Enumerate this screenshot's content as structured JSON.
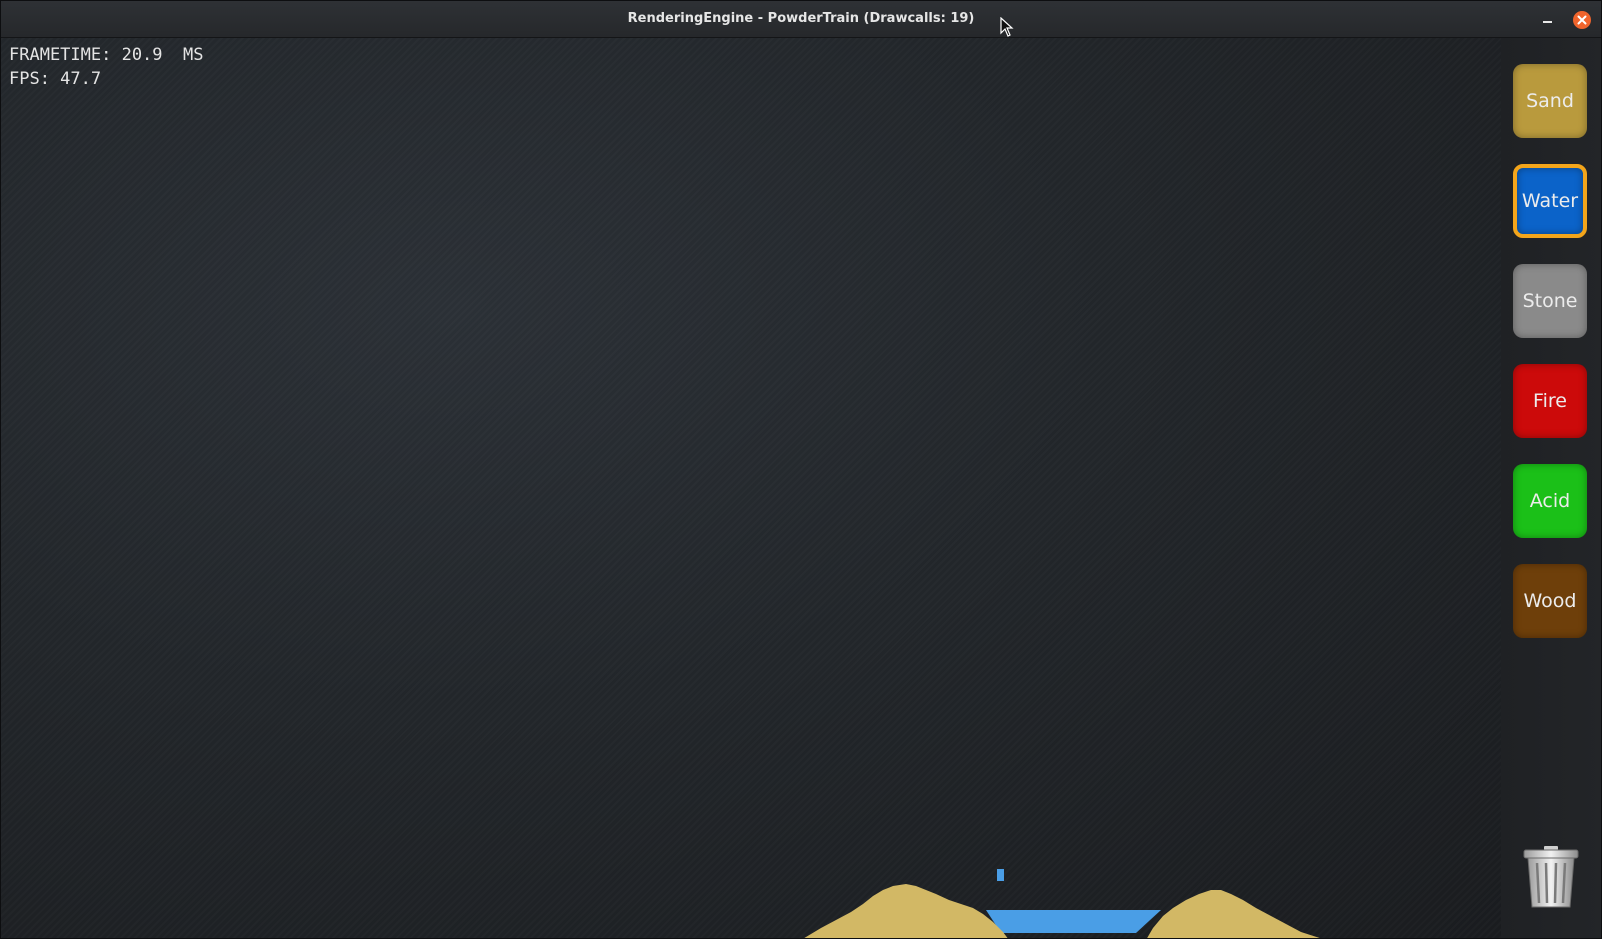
{
  "window": {
    "title": "RenderingEngine - PowderTrain (Drawcalls: 19)"
  },
  "hud": {
    "frametime": "FRAMETIME: 20.9  MS",
    "fps": "FPS: 47.7"
  },
  "materials": [
    {
      "label": "Sand",
      "color": "#b99a3d",
      "selected": false
    },
    {
      "label": "Water",
      "color": "#0b63c9",
      "selected": true
    },
    {
      "label": "Stone",
      "color": "#8a8a8a",
      "selected": false
    },
    {
      "label": "Fire",
      "color": "#cc0a0a",
      "selected": false
    },
    {
      "label": "Acid",
      "color": "#1bc018",
      "selected": false
    },
    {
      "label": "Wood",
      "color": "#6e3f0a",
      "selected": false
    }
  ],
  "colors": {
    "sand": "#d2b865",
    "water": "#4a9ee6",
    "selection_border": "#f3a51b",
    "close_button": "#f0642c"
  },
  "icons": {
    "minimize": "minimize-icon",
    "close": "close-icon",
    "trash": "trash-icon",
    "cursor": "cursor-icon"
  }
}
